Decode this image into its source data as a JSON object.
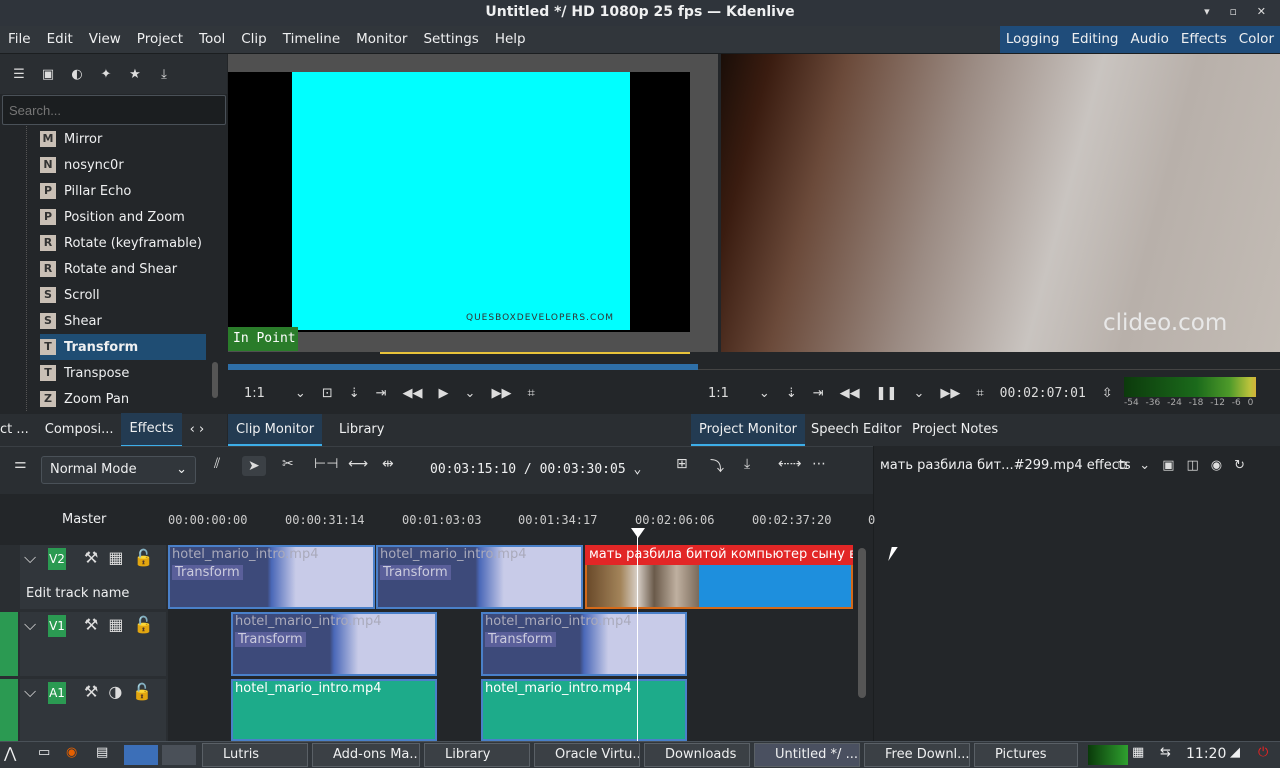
{
  "window": {
    "title": "Untitled */ HD 1080p 25 fps — Kdenlive",
    "buttons": "▾ ▫ ✕"
  },
  "menu": [
    "File",
    "Edit",
    "View",
    "Project",
    "Tool",
    "Clip",
    "Timeline",
    "Monitor",
    "Settings",
    "Help"
  ],
  "workspaces": [
    "Logging",
    "Editing",
    "Audio",
    "Effects",
    "Color"
  ],
  "left_panel": {
    "icons": [
      "list-icon",
      "save-icon",
      "audio-icon",
      "custom-icon",
      "star-icon",
      "download-icon"
    ],
    "search_placeholder": "Search...",
    "effects": [
      {
        "badge": "M",
        "name": "Mirror"
      },
      {
        "badge": "N",
        "name": "nosync0r"
      },
      {
        "badge": "P",
        "name": "Pillar Echo"
      },
      {
        "badge": "P",
        "name": "Position and Zoom"
      },
      {
        "badge": "R",
        "name": "Rotate (keyframable)"
      },
      {
        "badge": "R",
        "name": "Rotate and Shear"
      },
      {
        "badge": "S",
        "name": "Scroll"
      },
      {
        "badge": "S",
        "name": "Shear"
      },
      {
        "badge": "T",
        "name": "Transform",
        "selected": true
      },
      {
        "badge": "T",
        "name": "Transpose"
      },
      {
        "badge": "Z",
        "name": "Zoom Pan"
      }
    ],
    "tabs": [
      "ct ...",
      "Composi...",
      "Effects"
    ],
    "tab_arrows": "‹ ›"
  },
  "clip_monitor": {
    "watermark": "QUESBOXDEVELOPERS.COM",
    "in_point": "In Point",
    "zoom": "1:1"
  },
  "project_monitor": {
    "watermark": "clideo.com",
    "zoom": "1:1",
    "timecode": "00:02:07:01",
    "vu_labels": "-54 -36 -24 -18 -12 -6 0"
  },
  "monitor_tabs": [
    "Clip Monitor",
    "Library",
    "Project Monitor",
    "Speech Editor",
    "Project Notes"
  ],
  "timeline": {
    "mode": "Normal Mode",
    "timecode": "00:03:15:10 / 00:03:30:05",
    "master": "Master",
    "ticks": [
      "00:00:00:00",
      "00:00:31:14",
      "00:01:03:03",
      "00:01:34:17",
      "00:02:06:06",
      "00:02:37:20",
      "0"
    ],
    "tracks": [
      {
        "name": "V2",
        "edit": "Edit track name"
      },
      {
        "name": "V1"
      },
      {
        "name": "A1"
      }
    ],
    "clips": {
      "v2_1": {
        "label": "hotel_mario_intro.mp4",
        "effect": "Transform"
      },
      "v2_2": {
        "label": "hotel_mario_intro.mp4",
        "effect": "Transform"
      },
      "v2_3": {
        "label": "мать разбила битой компьютер сыну в ре"
      },
      "v1_1": {
        "label": "hotel_mario_intro.mp4",
        "effect": "Transform"
      },
      "v1_2": {
        "label": "hotel_mario_intro.mp4",
        "effect": "Transform"
      },
      "a1_1": {
        "label": "hotel_mario_intro.mp4"
      },
      "a1_2": {
        "label": "hotel_mario_intro.mp4"
      }
    }
  },
  "effect_stack": {
    "title": "мать разбила бит...#299.mp4 effects"
  },
  "taskbar": {
    "tasks": [
      "Lutris",
      "Add-ons Ma...",
      "Library",
      "Oracle Virtu...",
      "Downloads",
      "Untitled */ ...",
      "Free Downl...",
      "Pictures"
    ],
    "clock": "11:20"
  }
}
